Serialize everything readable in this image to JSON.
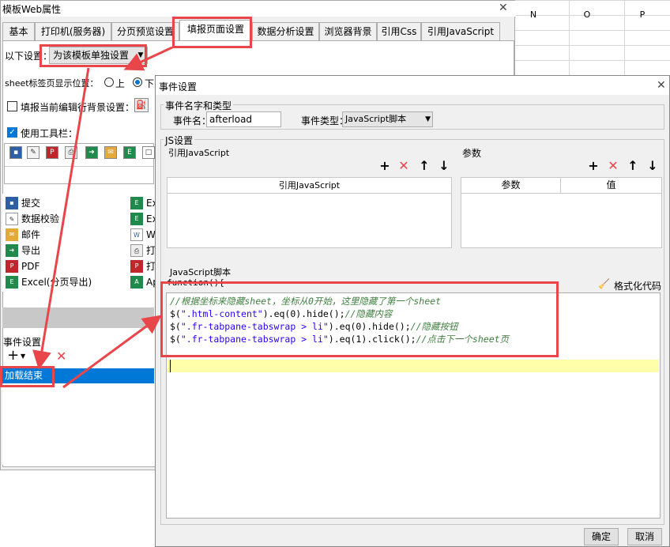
{
  "sheet": {
    "columns": [
      "N",
      "O",
      "P"
    ]
  },
  "bg_window": {
    "title": "模板Web属性",
    "close": "✕",
    "tabs": [
      "基本",
      "打印机(服务器)",
      "分页预览设置",
      "填报页面设置",
      "数据分析设置",
      "浏览器背景",
      "引用Css",
      "引用JavaScript"
    ],
    "active_tab": "填报页面设置",
    "setting_label": "以下设置：",
    "setting_value": "为该模板单独设置",
    "sheet_label": "sheet标签页显示位置：",
    "radio_top": "上",
    "radio_bottom": "下",
    "bg_label": "填报当前编辑行背景设置：",
    "toolbar_label": "使用工具栏：",
    "list_left": [
      "提交",
      "数据校验",
      "邮件",
      "导出",
      "PDF",
      "Excel(分页导出)"
    ],
    "list_right": [
      "Ex",
      "Ex",
      "Wo",
      "打",
      "打",
      "Ap"
    ],
    "events_label": "事件设置",
    "event_item": "加载结束"
  },
  "dialog": {
    "title": "事件设置",
    "close": "✕",
    "group1": "事件名字和类型",
    "name_label": "事件名：",
    "name_value": "afterload",
    "type_label": "事件类型：",
    "type_value": "JavaScript脚本",
    "group2": "JS设置",
    "ref_js_label": "引用JavaScript",
    "params_label": "参数",
    "ref_js_col": "引用JavaScript",
    "param_col": "参数",
    "value_col": "值",
    "script_label": "JavaScript脚本",
    "func_open": "function(){",
    "format_btn": "格式化代码",
    "func_close": "}",
    "code_lines": [
      {
        "comment": "//根据坐标来隐藏sheet，坐标从0开始，这里隐藏了第一个sheet"
      },
      {
        "a": "$(",
        "s": "\".html-content\"",
        "b": ").eq(0).hide();",
        "comment": "//隐藏内容"
      },
      {
        "a": "$(",
        "s": "\".fr-tabpane-tabswrap > li\"",
        "b": ").eq(0).hide();",
        "comment": "//隐藏按钮"
      },
      {
        "a": "$(",
        "s": "\".fr-tabpane-tabswrap > li\"",
        "b": ").eq(1).click();",
        "comment": "//点击下一个sheet页"
      }
    ],
    "ok": "确定",
    "cancel": "取消"
  },
  "colors": {
    "accent": "#0078d7",
    "highlight": "#e8464a",
    "comment": "#3f7f3f",
    "string": "#2a00ff"
  }
}
